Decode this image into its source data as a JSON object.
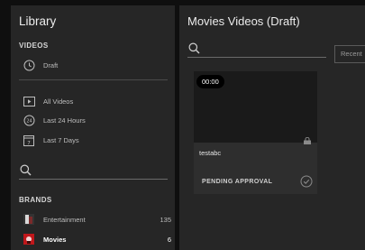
{
  "sidebar": {
    "title": "Library",
    "videos_section_label": "VIDEOS",
    "draft_item": {
      "label": "Draft",
      "icon": "clock-icon"
    },
    "items": [
      {
        "label": "All Videos",
        "icon": "video-icon"
      },
      {
        "label": "Last 24 Hours",
        "icon": "clock-24-icon"
      },
      {
        "label": "Last 7 Days",
        "icon": "calendar-icon"
      }
    ],
    "search": {
      "placeholder": "",
      "value": ""
    },
    "brands_section_label": "BRANDS",
    "brands": [
      {
        "label": "Entertainment",
        "count": "135",
        "icon": "brand-thumbnail",
        "active": false
      },
      {
        "label": "Movies",
        "count": "6",
        "icon": "brand-thumbnail",
        "active": true
      }
    ]
  },
  "main": {
    "title": "Movies Videos (Draft)",
    "search": {
      "placeholder": "",
      "value": ""
    },
    "sort_label": "Recent",
    "videos": [
      {
        "title": "testabc",
        "duration": "00:00",
        "status": "PENDING APPROVAL"
      }
    ]
  },
  "colors": {
    "background": "#0f0f0f",
    "panel": "#262626",
    "card": "#2e2e2e",
    "thumbnail": "#1a1a1a",
    "movies_brand_accent": "#c0171b"
  }
}
